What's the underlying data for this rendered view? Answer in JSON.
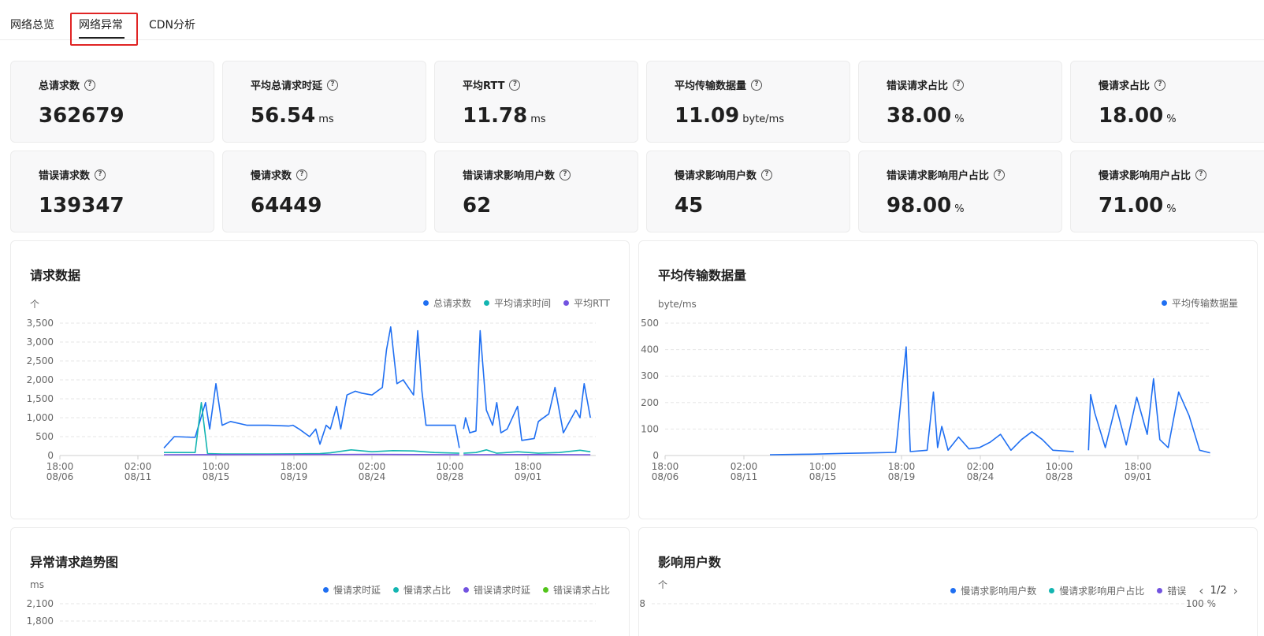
{
  "tabs": [
    {
      "label": "网络总览",
      "active": false
    },
    {
      "label": "网络异常",
      "active": true
    },
    {
      "label": "CDN分析",
      "active": false
    }
  ],
  "metrics": [
    {
      "label": "总请求数",
      "value": "362679",
      "unit": ""
    },
    {
      "label": "平均总请求时延",
      "value": "56.54",
      "unit": "ms"
    },
    {
      "label": "平均RTT",
      "value": "11.78",
      "unit": "ms"
    },
    {
      "label": "平均传输数据量",
      "value": "11.09",
      "unit": "byte/ms"
    },
    {
      "label": "错误请求占比",
      "value": "38.00",
      "unit": "%"
    },
    {
      "label": "慢请求占比",
      "value": "18.00",
      "unit": "%"
    },
    {
      "label": "错误请求数",
      "value": "139347",
      "unit": ""
    },
    {
      "label": "慢请求数",
      "value": "64449",
      "unit": ""
    },
    {
      "label": "错误请求影响用户数",
      "value": "62",
      "unit": ""
    },
    {
      "label": "慢请求影响用户数",
      "value": "45",
      "unit": ""
    },
    {
      "label": "错误请求影响用户占比",
      "value": "98.00",
      "unit": "%"
    },
    {
      "label": "慢请求影响用户占比",
      "value": "71.00",
      "unit": "%"
    }
  ],
  "colors": {
    "blue": "#1f6ff2",
    "teal": "#13b5b1",
    "purple": "#7253e0",
    "green": "#52c41a",
    "grid": "#e6e6e6",
    "tab_highlight": "#e02424"
  },
  "chart_data": [
    {
      "id": "request",
      "type": "line",
      "title": "请求数据",
      "ylabel": "个",
      "ylim": [
        0,
        3500
      ],
      "yticks": [
        "3,500",
        "3,000",
        "2,500",
        "2,000",
        "1,500",
        "1,000",
        "500",
        "0"
      ],
      "xticks": [
        [
          "18:00",
          "08/06"
        ],
        [
          "02:00",
          "08/11"
        ],
        [
          "10:00",
          "08/15"
        ],
        [
          "18:00",
          "08/19"
        ],
        [
          "02:00",
          "08/24"
        ],
        [
          "10:00",
          "08/28"
        ],
        [
          "18:00",
          "09/01"
        ]
      ],
      "legend": [
        {
          "name": "总请求数",
          "color": "#1f6ff2"
        },
        {
          "name": "平均请求时间",
          "color": "#13b5b1"
        },
        {
          "name": "平均RTT",
          "color": "#7253e0"
        }
      ],
      "series": [
        {
          "name": "总请求数",
          "color": "#1f6ff2",
          "segments": [
            [
              [
                0.5,
                200
              ],
              [
                0.55,
                500
              ],
              [
                0.65,
                480
              ],
              [
                0.7,
                1400
              ],
              [
                0.72,
                700
              ],
              [
                0.75,
                1900
              ],
              [
                0.78,
                800
              ],
              [
                0.82,
                900
              ],
              [
                0.9,
                800
              ],
              [
                1.0,
                800
              ],
              [
                1.1,
                780
              ],
              [
                1.12,
                800
              ],
              [
                1.15,
                700
              ],
              [
                1.2,
                500
              ],
              [
                1.23,
                700
              ],
              [
                1.25,
                300
              ],
              [
                1.28,
                800
              ],
              [
                1.3,
                700
              ],
              [
                1.33,
                1300
              ],
              [
                1.35,
                700
              ],
              [
                1.38,
                1600
              ],
              [
                1.42,
                1700
              ],
              [
                1.45,
                1650
              ],
              [
                1.5,
                1600
              ],
              [
                1.55,
                1800
              ],
              [
                1.57,
                2800
              ],
              [
                1.59,
                3400
              ],
              [
                1.62,
                1900
              ],
              [
                1.65,
                2000
              ],
              [
                1.7,
                1600
              ],
              [
                1.72,
                3300
              ],
              [
                1.74,
                1700
              ],
              [
                1.76,
                800
              ],
              [
                1.78,
                800
              ],
              [
                1.85,
                800
              ],
              [
                1.9,
                800
              ],
              [
                1.92,
                200
              ]
            ],
            [
              [
                1.94,
                700
              ],
              [
                1.95,
                1000
              ],
              [
                1.97,
                600
              ],
              [
                2.0,
                650
              ],
              [
                2.02,
                3300
              ],
              [
                2.05,
                1200
              ],
              [
                2.08,
                800
              ],
              [
                2.1,
                1400
              ],
              [
                2.12,
                600
              ],
              [
                2.15,
                700
              ],
              [
                2.2,
                1300
              ],
              [
                2.22,
                400
              ],
              [
                2.28,
                450
              ],
              [
                2.3,
                900
              ],
              [
                2.35,
                1100
              ],
              [
                2.38,
                1800
              ],
              [
                2.42,
                600
              ],
              [
                2.45,
                900
              ],
              [
                2.48,
                1200
              ],
              [
                2.5,
                1000
              ],
              [
                2.52,
                1900
              ],
              [
                2.55,
                1000
              ]
            ]
          ]
        },
        {
          "name": "平均请求时间",
          "color": "#13b5b1",
          "segments": [
            [
              [
                0.5,
                80
              ],
              [
                0.65,
                80
              ],
              [
                0.68,
                1400
              ],
              [
                0.71,
                50
              ],
              [
                0.78,
                40
              ],
              [
                1.0,
                40
              ],
              [
                1.25,
                50
              ],
              [
                1.3,
                70
              ],
              [
                1.4,
                150
              ],
              [
                1.5,
                100
              ],
              [
                1.6,
                130
              ],
              [
                1.7,
                120
              ],
              [
                1.8,
                80
              ],
              [
                1.92,
                60
              ]
            ],
            [
              [
                1.94,
                60
              ],
              [
                2.0,
                80
              ],
              [
                2.05,
                150
              ],
              [
                2.1,
                60
              ],
              [
                2.2,
                100
              ],
              [
                2.3,
                60
              ],
              [
                2.4,
                80
              ],
              [
                2.5,
                140
              ],
              [
                2.55,
                100
              ]
            ]
          ]
        },
        {
          "name": "平均RTT",
          "color": "#7253e0",
          "segments": [
            [
              [
                0.5,
                20
              ],
              [
                1.0,
                25
              ],
              [
                1.5,
                30
              ],
              [
                1.92,
                20
              ]
            ],
            [
              [
                1.94,
                20
              ],
              [
                2.25,
                25
              ],
              [
                2.55,
                20
              ]
            ]
          ]
        }
      ]
    },
    {
      "id": "transfer",
      "type": "line",
      "title": "平均传输数据量",
      "ylabel": "byte/ms",
      "ylim": [
        0,
        500
      ],
      "yticks": [
        "500",
        "400",
        "300",
        "200",
        "100",
        "0"
      ],
      "xticks": [
        [
          "18:00",
          "08/06"
        ],
        [
          "02:00",
          "08/11"
        ],
        [
          "10:00",
          "08/15"
        ],
        [
          "18:00",
          "08/19"
        ],
        [
          "02:00",
          "08/24"
        ],
        [
          "10:00",
          "08/28"
        ],
        [
          "18:00",
          "09/01"
        ]
      ],
      "legend": [
        {
          "name": "平均传输数据量",
          "color": "#1f6ff2"
        }
      ],
      "series": [
        {
          "name": "平均传输数据量",
          "color": "#1f6ff2",
          "segments": [
            [
              [
                0.5,
                3
              ],
              [
                0.7,
                5
              ],
              [
                0.85,
                8
              ],
              [
                1.0,
                10
              ],
              [
                1.1,
                12
              ],
              [
                1.15,
                410
              ],
              [
                1.17,
                15
              ],
              [
                1.25,
                20
              ],
              [
                1.28,
                240
              ],
              [
                1.3,
                30
              ],
              [
                1.32,
                110
              ],
              [
                1.35,
                20
              ],
              [
                1.4,
                70
              ],
              [
                1.45,
                25
              ],
              [
                1.5,
                30
              ],
              [
                1.55,
                50
              ],
              [
                1.6,
                80
              ],
              [
                1.65,
                20
              ],
              [
                1.7,
                60
              ],
              [
                1.75,
                90
              ],
              [
                1.8,
                60
              ],
              [
                1.85,
                20
              ],
              [
                1.95,
                15
              ]
            ],
            [
              [
                2.02,
                20
              ],
              [
                2.03,
                230
              ],
              [
                2.05,
                160
              ],
              [
                2.1,
                30
              ],
              [
                2.15,
                190
              ],
              [
                2.2,
                40
              ],
              [
                2.25,
                220
              ],
              [
                2.3,
                80
              ],
              [
                2.33,
                290
              ],
              [
                2.36,
                60
              ],
              [
                2.4,
                30
              ],
              [
                2.45,
                240
              ],
              [
                2.5,
                150
              ],
              [
                2.55,
                20
              ],
              [
                2.6,
                10
              ]
            ]
          ]
        }
      ]
    },
    {
      "id": "abnormal",
      "type": "line",
      "title": "异常请求趋势图",
      "ylabel": "ms",
      "ylim": [
        0,
        2100
      ],
      "yticks": [
        "2,100",
        "1,800"
      ],
      "legend": [
        {
          "name": "慢请求时延",
          "color": "#1f6ff2"
        },
        {
          "name": "慢请求占比",
          "color": "#13b5b1"
        },
        {
          "name": "错误请求时延",
          "color": "#7253e0"
        },
        {
          "name": "错误请求占比",
          "color": "#52c41a"
        }
      ],
      "series": []
    },
    {
      "id": "users",
      "type": "line",
      "title": "影响用户数",
      "ylabel": "个",
      "ylim": [
        0,
        8
      ],
      "yticks": [
        "8"
      ],
      "y2ticks": [
        "100 %"
      ],
      "legend": [
        {
          "name": "慢请求影响用户数",
          "color": "#1f6ff2"
        },
        {
          "name": "慢请求影响用户占比",
          "color": "#13b5b1"
        },
        {
          "name": "错误",
          "color": "#7253e0"
        }
      ],
      "pager": "1/2",
      "series": []
    }
  ]
}
